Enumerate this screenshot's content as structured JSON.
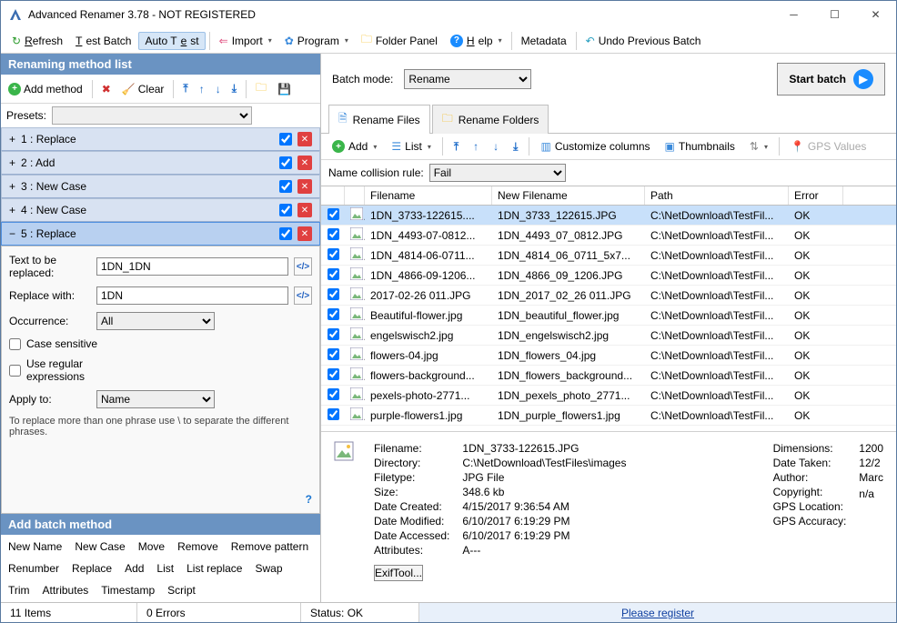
{
  "window": {
    "title": "Advanced Renamer 3.78 - NOT REGISTERED"
  },
  "toolbar": {
    "refresh": "Refresh",
    "testbatch": "Test Batch",
    "autotest": "Auto Test",
    "import": "Import",
    "program": "Program",
    "folderpanel": "Folder Panel",
    "help": "Help",
    "metadata": "Metadata",
    "undo": "Undo Previous Batch"
  },
  "left": {
    "heading": "Renaming method list",
    "addmethod": "Add method",
    "clear": "Clear",
    "presets": "Presets:",
    "methods": [
      {
        "label": "1 : Replace",
        "active": false
      },
      {
        "label": "2 : Add",
        "active": false
      },
      {
        "label": "3 : New Case",
        "active": false
      },
      {
        "label": "4 : New Case",
        "active": false
      },
      {
        "label": "5 : Replace",
        "active": true
      }
    ],
    "replace": {
      "text_label": "Text to be replaced:",
      "text_value": "1DN_1DN",
      "with_label": "Replace with:",
      "with_value": "1DN",
      "occurrence_label": "Occurrence:",
      "occurrence_value": "All",
      "case": "Case sensitive",
      "regex": "Use regular expressions",
      "apply_label": "Apply to:",
      "apply_value": "Name",
      "hint": "To replace more than one phrase use \\ to separate the different phrases."
    },
    "addbatch_heading": "Add batch method",
    "addbatch": [
      "New Name",
      "New Case",
      "Move",
      "Remove",
      "Remove pattern",
      "Renumber",
      "Replace",
      "Add",
      "List",
      "List replace",
      "Swap",
      "Trim",
      "Attributes",
      "Timestamp",
      "Script"
    ]
  },
  "right": {
    "batchmode_label": "Batch mode:",
    "batchmode_value": "Rename",
    "startbatch": "Start batch",
    "tab_files": "Rename Files",
    "tab_folders": "Rename Folders",
    "filebar": {
      "add": "Add",
      "list": "List",
      "custom": "Customize columns",
      "thumbs": "Thumbnails",
      "gps": "GPS Values"
    },
    "collision_label": "Name collision rule:",
    "collision_value": "Fail",
    "headers": {
      "fn": "Filename",
      "nfn": "New Filename",
      "path": "Path",
      "err": "Error"
    },
    "rows": [
      {
        "fn": "1DN_3733-122615....",
        "nfn": "1DN_3733_122615.JPG",
        "path": "C:\\NetDownload\\TestFil...",
        "err": "OK",
        "sel": true
      },
      {
        "fn": "1DN_4493-07-0812...",
        "nfn": "1DN_4493_07_0812.JPG",
        "path": "C:\\NetDownload\\TestFil...",
        "err": "OK"
      },
      {
        "fn": "1DN_4814-06-0711...",
        "nfn": "1DN_4814_06_0711_5x7...",
        "path": "C:\\NetDownload\\TestFil...",
        "err": "OK"
      },
      {
        "fn": "1DN_4866-09-1206...",
        "nfn": "1DN_4866_09_1206.JPG",
        "path": "C:\\NetDownload\\TestFil...",
        "err": "OK"
      },
      {
        "fn": "2017-02-26 011.JPG",
        "nfn": "1DN_2017_02_26 011.JPG",
        "path": "C:\\NetDownload\\TestFil...",
        "err": "OK"
      },
      {
        "fn": "Beautiful-flower.jpg",
        "nfn": "1DN_beautiful_flower.jpg",
        "path": "C:\\NetDownload\\TestFil...",
        "err": "OK"
      },
      {
        "fn": "engelswisch2.jpg",
        "nfn": "1DN_engelswisch2.jpg",
        "path": "C:\\NetDownload\\TestFil...",
        "err": "OK"
      },
      {
        "fn": "flowers-04.jpg",
        "nfn": "1DN_flowers_04.jpg",
        "path": "C:\\NetDownload\\TestFil...",
        "err": "OK"
      },
      {
        "fn": "flowers-background...",
        "nfn": "1DN_flowers_background...",
        "path": "C:\\NetDownload\\TestFil...",
        "err": "OK"
      },
      {
        "fn": "pexels-photo-2771...",
        "nfn": "1DN_pexels_photo_2771...",
        "path": "C:\\NetDownload\\TestFil...",
        "err": "OK"
      },
      {
        "fn": "purple-flowers1.jpg",
        "nfn": "1DN_purple_flowers1.jpg",
        "path": "C:\\NetDownload\\TestFil...",
        "err": "OK"
      }
    ],
    "info": {
      "l": {
        "fn": "Filename:",
        "dir": "Directory:",
        "ft": "Filetype:",
        "sz": "Size:",
        "dc": "Date Created:",
        "dm": "Date Modified:",
        "da": "Date Accessed:",
        "at": "Attributes:"
      },
      "v": {
        "fn": "1DN_3733-122615.JPG",
        "dir": "C:\\NetDownload\\TestFiles\\images",
        "ft": "JPG File",
        "sz": "348.6 kb",
        "dc": "4/15/2017 9:36:54 AM",
        "dm": "6/10/2017 6:19:29 PM",
        "da": "6/10/2017 6:19:29 PM",
        "at": "A---"
      },
      "r": {
        "dim": "Dimensions:",
        "dt": "Date Taken:",
        "au": "Author:",
        "cp": "Copyright:",
        "gl": "GPS Location:",
        "ga": "GPS Accuracy:"
      },
      "rv": {
        "dim": "1200",
        "dt": "12/2",
        "au": "Marc",
        "cp": "",
        "gl": "n/a",
        "ga": ""
      },
      "exif": "ExifTool..."
    }
  },
  "status": {
    "items": "11 Items",
    "errors": "0 Errors",
    "state_l": "Status:",
    "state_v": "OK",
    "register": "Please register"
  }
}
